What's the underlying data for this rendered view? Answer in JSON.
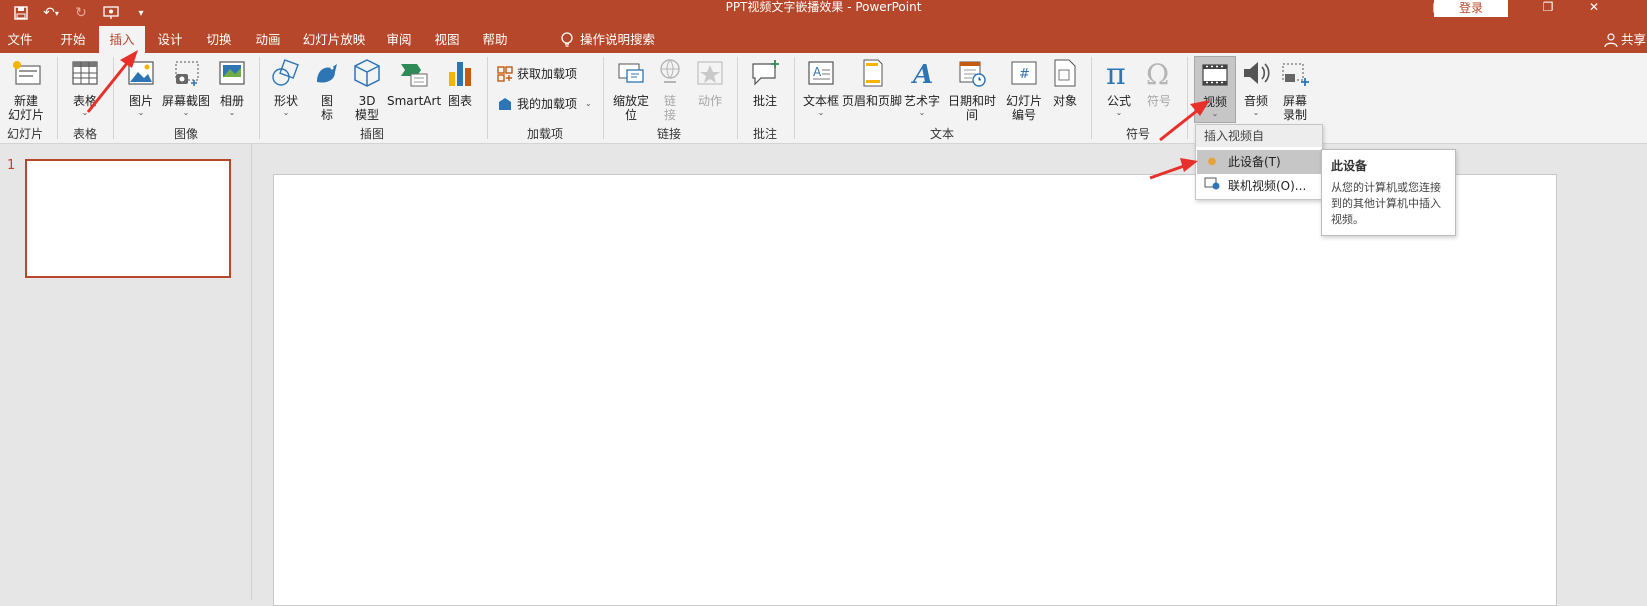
{
  "titlebar": {
    "title": "PPT视频文字嵌播效果  -  PowerPoint",
    "signin": "登录",
    "qat": [
      "save-icon",
      "undo-icon",
      "redo-icon",
      "present-icon",
      "customize-icon"
    ]
  },
  "tabs": [
    "文件",
    "开始",
    "插入",
    "设计",
    "切换",
    "动画",
    "幻灯片放映",
    "审阅",
    "视图",
    "帮助"
  ],
  "active_tab": "插入",
  "tell_me": "操作说明搜索",
  "share": "共享",
  "ribbon": {
    "new_slide": "新建\n幻灯片",
    "table": "表格",
    "pictures": "图片",
    "screenshot": "屏幕截图",
    "album": "相册",
    "shapes": "形状",
    "icons": "图\n标",
    "models3d": "3D\n模型",
    "smartart": "SmartArt",
    "chart": "图表",
    "get_addins": "获取加载项",
    "my_addins": "我的加载项",
    "zoom": "缩放定\n位",
    "link": "链\n接",
    "action": "动作",
    "comment": "批注",
    "textbox": "文本框",
    "header_footer": "页眉和页脚",
    "wordart": "艺术字",
    "datetime": "日期和时间",
    "slide_number": "幻灯片\n编号",
    "object": "对象",
    "equation": "公式",
    "symbol": "符号",
    "video": "视频",
    "audio": "音频",
    "screen_recording": "屏幕\n录制",
    "groups": {
      "slides": "幻灯片",
      "tables": "表格",
      "images": "图像",
      "illustrations": "插图",
      "addins": "加载项",
      "links": "链接",
      "comments": "批注",
      "text": "文本",
      "symbols": "符号"
    }
  },
  "slide_panel": {
    "slide_number": "1"
  },
  "video_menu": {
    "header": "插入视频自",
    "items": [
      "此设备(T)",
      "联机视频(O)..."
    ]
  },
  "tooltip": {
    "title": "此设备",
    "body": "从您的计算机或您连接到的其他计算机中插入视频。"
  },
  "colors": {
    "accent": "#b7472a",
    "ribbon_bg": "#f3f3f3",
    "workspace_bg": "#e6e6e6",
    "annotation_red": "#e8302a"
  }
}
